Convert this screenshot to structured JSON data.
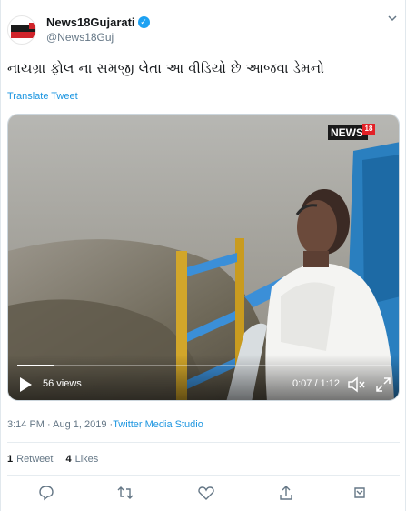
{
  "account": {
    "display_name": "News18Gujarati",
    "handle": "@News18Guj",
    "verified_icon": "verified-check-icon"
  },
  "tweet": {
    "text": "નાયગ્રા ફોલ ના સમજી લેતા આ વીડિયો છે આજવા ડેમનો",
    "translate_label": "Translate Tweet"
  },
  "video": {
    "logo_text": "NEWS",
    "logo_number": "18",
    "views": "56 views",
    "time": "0:07 / 1:12",
    "progress": 0.097
  },
  "meta": {
    "timestamp": "3:14 PM · Aug 1, 2019 · ",
    "source": "Twitter Media Studio"
  },
  "stats": {
    "retweets_count": "1",
    "retweets_label": "Retweet",
    "likes_count": "4",
    "likes_label": "Likes"
  },
  "colors": {
    "accent": "#1b95e0",
    "verified": "#1da1f2"
  },
  "actions": [
    "reply-icon",
    "retweet-icon",
    "like-icon",
    "share-icon",
    "bookmark-icon"
  ]
}
